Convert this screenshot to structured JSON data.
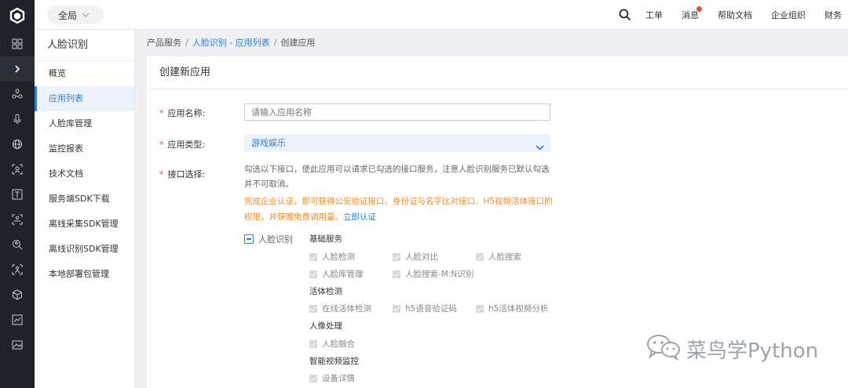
{
  "topbar": {
    "scope_label": "全局",
    "nav": [
      "工单",
      "消息",
      "帮助文档",
      "企业组织",
      "财务"
    ]
  },
  "rail_icons": [
    "grid-icon",
    "chevron-right-icon",
    "nodes-icon",
    "microphone-icon",
    "globe-icon",
    "face-scan-icon",
    "text-icon",
    "person-scan-icon",
    "search-face-icon",
    "body-scan-icon",
    "cube-icon",
    "image-chart-icon",
    "image-icon"
  ],
  "sidebar": {
    "title": "人脸识别",
    "items": [
      "概览",
      "应用列表",
      "人脸库管理",
      "监控报表",
      "技术文档",
      "服务端SDK下载",
      "离线采集SDK管理",
      "离线识别SDK管理",
      "本地部署包管理"
    ],
    "active_index": 1
  },
  "breadcrumb": {
    "root": "产品服务",
    "link": "人脸识别 - 应用列表",
    "current": "创建应用"
  },
  "form": {
    "title": "创建新应用",
    "name_label": "应用名称:",
    "name_placeholder": "请输入应用名称",
    "type_label": "应用类型:",
    "type_value": "游戏娱乐",
    "api_label": "接口选择:",
    "api_desc": "勾选以下接口，使此应用可以请求已勾选的接口服务，注意人脸识别服务已默认勾选并不可取消。",
    "notice": "完成企业认证，即可获得公安验证接口、身份证与名字比对接口、H5视频活体接口的权限，并获赠免费调用量。",
    "notice_link": "立即认证",
    "group_label": "人脸识别",
    "sections": {
      "basic": "基础服务",
      "liveness": "活体检测",
      "image": "人像处理",
      "video": "智能视频监控"
    },
    "checks": {
      "detect": "人脸检测",
      "compare": "人脸对比",
      "search": "人脸搜索",
      "lib": "人脸库管理",
      "mn": "人脸搜索-M:N识别",
      "online": "在线活体检测",
      "h5code": "h5语音验证码",
      "h5video": "h5活体视频分析",
      "merge": "人脸融合",
      "device": "设备详情"
    }
  },
  "watermark": "菜鸟学Python"
}
